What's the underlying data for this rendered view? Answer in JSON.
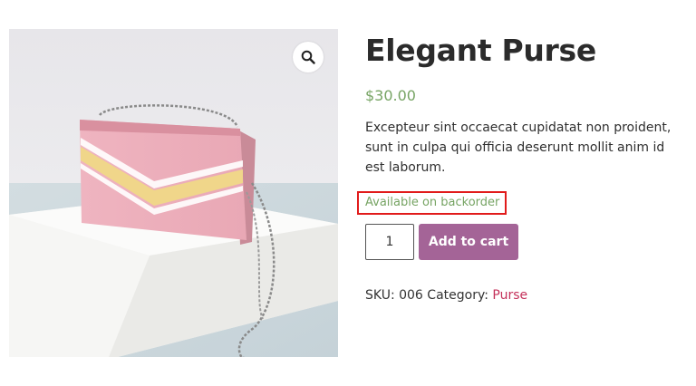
{
  "product": {
    "title": "Elegant Purse",
    "price": "$30.00",
    "description": "Excepteur sint occaecat cupidatat non proident, sunt in culpa qui officia deserunt mollit anim id est laborum.",
    "stock_status": "Available on backorder",
    "quantity": "1",
    "add_to_cart_label": "Add to cart",
    "sku_label": "SKU:",
    "sku": "006",
    "category_label": "Category:",
    "category": "Purse"
  },
  "gallery": {
    "zoom_icon": "magnifier-icon"
  },
  "colors": {
    "price": "#77a464",
    "button": "#a46497",
    "category_link": "#c4315a",
    "highlight_border": "#e11b1b"
  }
}
